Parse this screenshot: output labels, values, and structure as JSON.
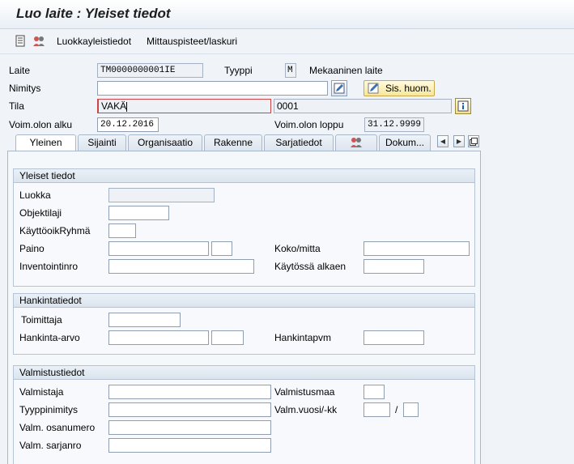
{
  "window": {
    "title": "Luo laite : Yleiset tiedot"
  },
  "toolbar": {
    "icon1": "document-list-icon",
    "icon2": "users-icon",
    "link1": "Luokkayleistiedot",
    "link2": "Mittauspisteet/laskuri"
  },
  "header": {
    "laite_label": "Laite",
    "laite_value": "TM0000000001IE",
    "tyyppi_label": "Tyyppi",
    "tyyppi_value": "M",
    "tyyppi_text": "Mekaaninen laite",
    "nimitys_label": "Nimitys",
    "nimitys_value": "",
    "sis_huom_label": "Sis. huom.",
    "tila_label": "Tila",
    "tila_value": "VAKÄ",
    "tila_code": "0001",
    "voim_alku_label": "Voim.olon alku",
    "voim_alku_value": "20.12.2016",
    "voim_loppu_label": "Voim.olon loppu",
    "voim_loppu_value": "31.12.9999"
  },
  "tabs": [
    {
      "label": "Yleinen"
    },
    {
      "label": "Sijainti"
    },
    {
      "label": "Organisaatio"
    },
    {
      "label": "Rakenne"
    },
    {
      "label": "Sarjatiedot"
    },
    {
      "label": ""
    },
    {
      "label": "Dokum..."
    }
  ],
  "general": {
    "title": "Yleiset tiedot",
    "luokka": "Luokka",
    "objektilaji": "Objektilaji",
    "kayttooikryhma": "KäyttöoikRyhmä",
    "paino": "Paino",
    "koko_mitta": "Koko/mitta",
    "inventointinro": "Inventointinro",
    "kaytossa_alkaen": "Käytössä alkaen"
  },
  "procurement": {
    "title": "Hankintatiedot",
    "toimittaja": "Toimittaja",
    "hankinta_arvo": "Hankinta-arvo",
    "hankintapvm": "Hankintapvm"
  },
  "manufacturer": {
    "title": "Valmistustiedot",
    "valmistaja": "Valmistaja",
    "valmistusmaa": "Valmistusmaa",
    "tyyppinimitys": "Tyyppinimitys",
    "valm_vuosi": "Valm.vuosi/-kk",
    "separator": "/",
    "osanumero": "Valm. osanumero",
    "sarjanro": "Valm. sarjanro"
  },
  "colors": {
    "accent": "#1a5fa8",
    "button": "#f6e79a",
    "background": "#f0f4f9"
  }
}
